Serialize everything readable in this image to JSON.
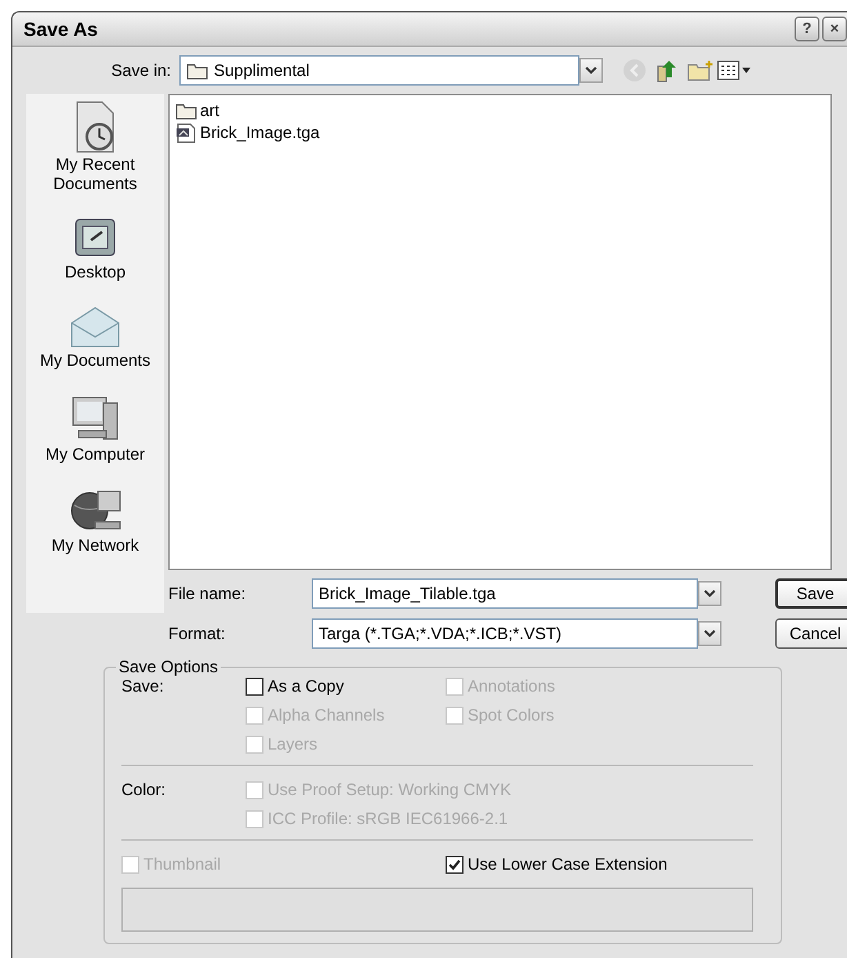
{
  "window": {
    "title": "Save As"
  },
  "title_buttons": [
    {
      "label": "?"
    },
    {
      "label": "×"
    }
  ],
  "save_in": {
    "label": "Save in:",
    "value": "Supplimental"
  },
  "toolbar": [
    {
      "kind": "back",
      "disabled": true
    },
    {
      "kind": "up",
      "disabled": false
    },
    {
      "kind": "new-folder",
      "disabled": false
    },
    {
      "kind": "views",
      "disabled": false
    }
  ],
  "places": [
    {
      "kind": "recent",
      "label": "My Recent Documents"
    },
    {
      "kind": "desktop",
      "label": "Desktop"
    },
    {
      "kind": "documents",
      "label": "My Documents"
    },
    {
      "kind": "computer",
      "label": "My Computer"
    },
    {
      "kind": "network",
      "label": "My Network"
    }
  ],
  "files": [
    {
      "kind": "folder",
      "name": "art",
      "selected": false
    },
    {
      "kind": "image",
      "name": "Brick_Image.tga",
      "selected": false
    }
  ],
  "file_name": {
    "label": "File name:",
    "value": "Brick_Image_Tilable.tga"
  },
  "format": {
    "label": "Format:",
    "value": "Targa (*.TGA;*.VDA;*.ICB;*.VST)"
  },
  "buttons": [
    {
      "label": "Save",
      "default": true
    },
    {
      "label": "Cancel",
      "default": false
    }
  ],
  "save_options": {
    "title": "Save Options",
    "save_label": "Save:",
    "save_checks": [
      {
        "label": "As a Copy",
        "checked": false,
        "disabled": false
      },
      {
        "label": "Annotations",
        "checked": false,
        "disabled": true
      },
      {
        "label": "Alpha Channels",
        "checked": false,
        "disabled": true
      },
      {
        "label": "Spot Colors",
        "checked": false,
        "disabled": true
      },
      {
        "label": "Layers",
        "checked": false,
        "disabled": true
      }
    ],
    "color_label": "Color:",
    "color_checks": [
      {
        "label": "Use Proof Setup:  Working CMYK",
        "checked": false,
        "disabled": true
      },
      {
        "label": "ICC Profile:  sRGB IEC61966-2.1",
        "checked": false,
        "disabled": true
      }
    ],
    "bottom_checks": [
      {
        "label": "Thumbnail",
        "checked": false,
        "disabled": true
      },
      {
        "label": "Use Lower Case Extension",
        "checked": true,
        "disabled": false
      }
    ]
  }
}
